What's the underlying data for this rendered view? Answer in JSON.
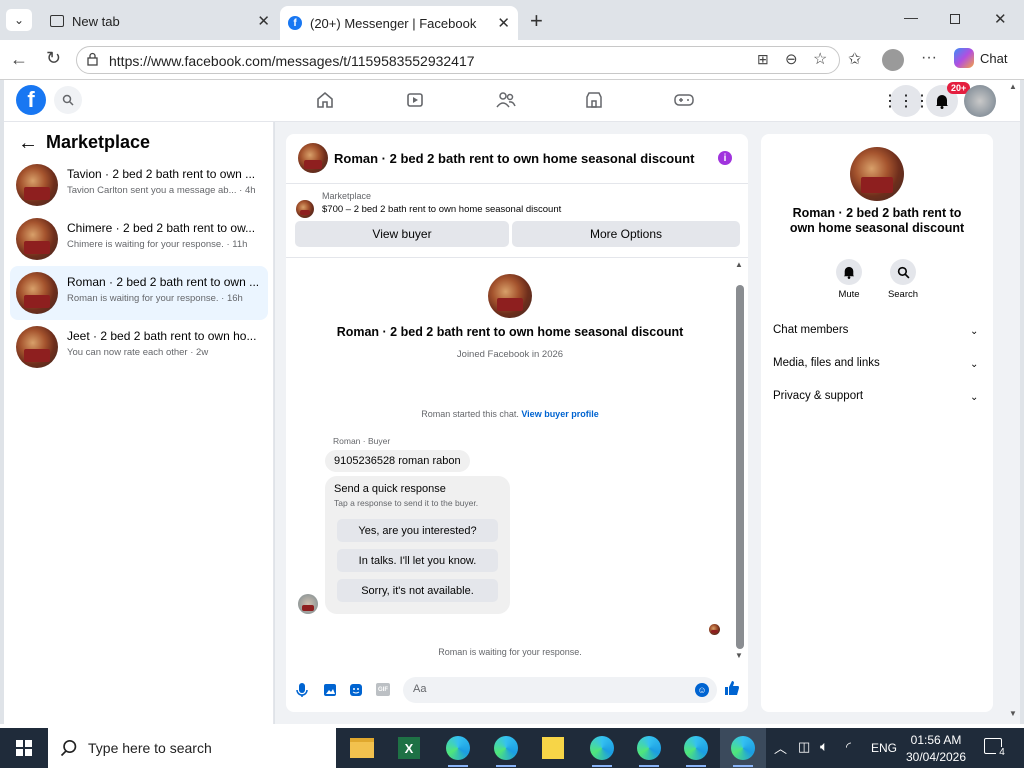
{
  "browser": {
    "tabs": [
      {
        "label": "New tab"
      },
      {
        "label": "(20+) Messenger | Facebook"
      }
    ],
    "url": "https://www.facebook.com/messages/t/1159583552932417",
    "chat_label": "Chat"
  },
  "facebook": {
    "notification_badge": "20+"
  },
  "sidebar": {
    "title": "Marketplace",
    "conversations": [
      {
        "name": "Tavion · 2 bed 2 bath rent to own ...",
        "preview": "Tavion Carlton sent you a message ab... · 4h"
      },
      {
        "name": "Chimere · 2 bed 2 bath rent to ow...",
        "preview": "Chimere is waiting for your response. · 11h"
      },
      {
        "name": "Roman · 2 bed 2 bath rent to own ...",
        "preview": "Roman is waiting for your response. · 16h"
      },
      {
        "name": "Jeet · 2 bed 2 bath rent to own ho...",
        "preview": "You can now rate each other · 2w"
      }
    ]
  },
  "chat": {
    "header_title": "Roman · 2 bed 2 bath rent to own home seasonal discount",
    "listing_source": "Marketplace",
    "listing_text": "$700 – 2 bed 2 bath rent to own home seasonal discount",
    "view_buyer": "View buyer",
    "more_options": "More Options",
    "profile_title": "Roman · 2 bed 2 bath rent to own home seasonal discount",
    "joined": "Joined Facebook in 2026",
    "started_text": "Roman started this chat.",
    "view_buyer_profile": "View buyer profile",
    "sender_label": "Roman · Buyer",
    "message": "9105236528 roman rabon",
    "quick_title": "Send a quick response",
    "quick_sub": "Tap a response to send it to the buyer.",
    "quick_replies": [
      "Yes, are you interested?",
      "In talks. I'll let you know.",
      "Sorry, it's not available."
    ],
    "waiting": "Roman is waiting for your response.",
    "input_placeholder": "Aa"
  },
  "details": {
    "title": "Roman · 2 bed 2 bath rent to own home seasonal discount",
    "mute": "Mute",
    "search": "Search",
    "sections": [
      "Chat members",
      "Media, files and links",
      "Privacy & support"
    ]
  },
  "taskbar": {
    "search_placeholder": "Type here to search",
    "language": "ENG",
    "time": "01:56 AM",
    "date": "30/04/2026",
    "notifications": "4"
  }
}
